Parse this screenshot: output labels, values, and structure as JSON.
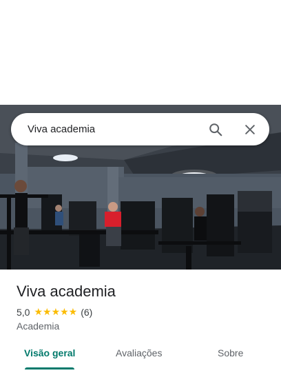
{
  "search": {
    "query": "Viva academia"
  },
  "place": {
    "name": "Viva academia",
    "rating": "5,0",
    "stars": "★★★★★",
    "review_count": "(6)",
    "category": "Academia"
  },
  "tabs": [
    {
      "label": "Visão geral",
      "active": true
    },
    {
      "label": "Avaliações",
      "active": false
    },
    {
      "label": "Sobre",
      "active": false
    }
  ],
  "colors": {
    "accent": "#00796b",
    "star": "#fbbc04"
  },
  "icons": {
    "search": "search-icon",
    "close": "close-icon"
  }
}
